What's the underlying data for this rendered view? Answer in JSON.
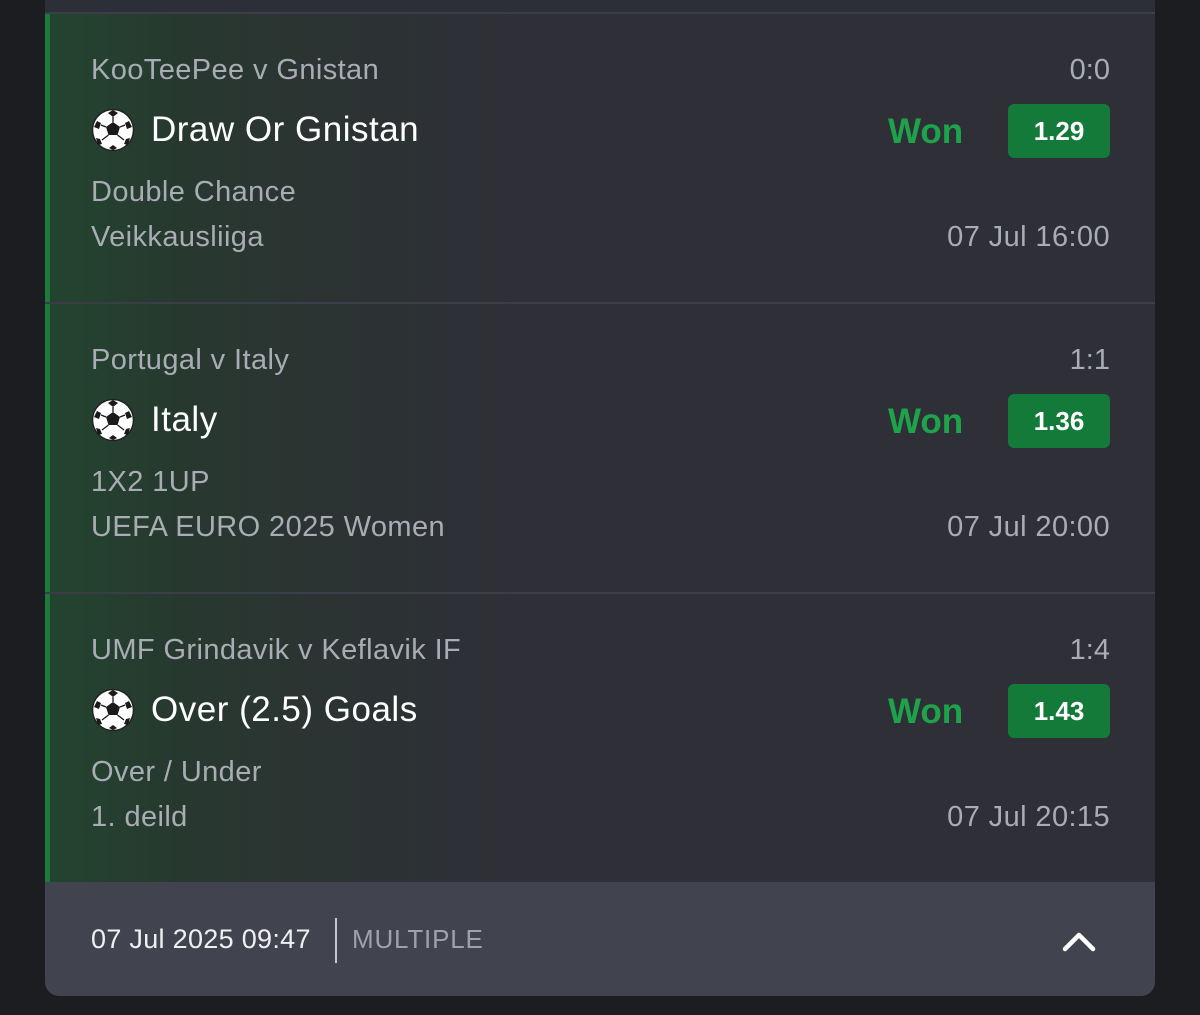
{
  "bets": [
    {
      "event": "KooTeePee v Gnistan",
      "score": "0:0",
      "sport_icon": "soccer-ball-icon",
      "selection": "Draw Or Gnistan",
      "status": "Won",
      "odds": "1.29",
      "market": "Double Chance",
      "league": "Veikkausliiga",
      "datetime": "07 Jul 16:00"
    },
    {
      "event": "Portugal v Italy",
      "score": "1:1",
      "sport_icon": "soccer-ball-icon",
      "selection": "Italy",
      "status": "Won",
      "odds": "1.36",
      "market": "1X2 1UP",
      "league": "UEFA EURO 2025 Women",
      "datetime": "07 Jul 20:00"
    },
    {
      "event": "UMF Grindavik v Keflavik IF",
      "score": "1:4",
      "sport_icon": "soccer-ball-icon",
      "selection": "Over (2.5) Goals",
      "status": "Won",
      "odds": "1.43",
      "market": "Over / Under",
      "league": "1. deild",
      "datetime": "07 Jul 20:15"
    }
  ],
  "footer": {
    "placed_at": "07 Jul 2025 09:47",
    "bet_type": "MULTIPLE",
    "collapse_icon": "chevron-up-icon"
  },
  "colors": {
    "won": "#1ea34b",
    "odds_badge": "#137a3a",
    "card_bg": "#2d2f38",
    "footer_bg": "#41434f"
  }
}
